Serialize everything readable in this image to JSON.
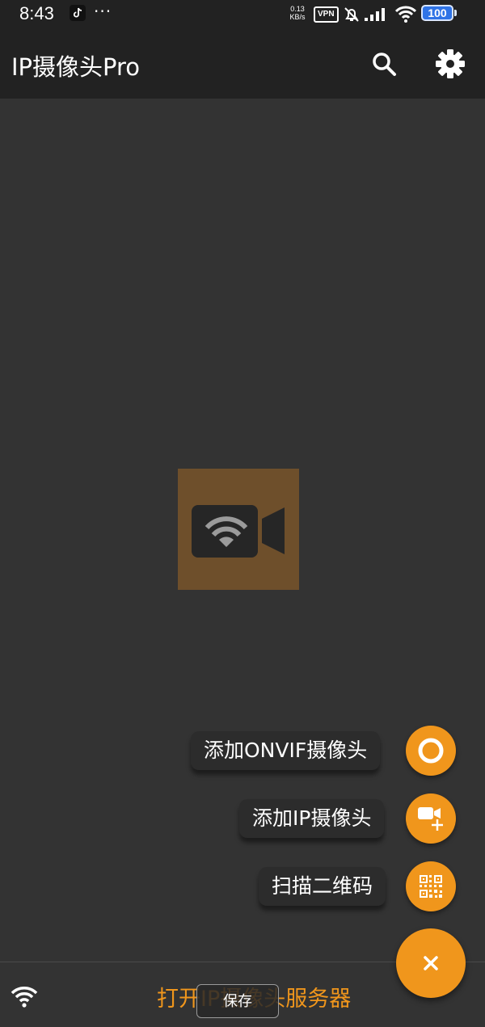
{
  "status_bar": {
    "time": "8:43",
    "notification_icon": "tiktok-icon",
    "more": "···",
    "net_speed_value": "0.13",
    "net_speed_unit": "KB/s",
    "vpn": "VPN",
    "battery": "100"
  },
  "app_bar": {
    "title": "IP摄像头Pro",
    "search_icon": "search-icon",
    "settings_icon": "gear-icon"
  },
  "center": {
    "logo_icon": "wifi-camera-icon"
  },
  "speed_dial": {
    "items": [
      {
        "label": "添加ONVIF摄像头",
        "icon": "onvif-ring-icon"
      },
      {
        "label": "添加IP摄像头",
        "icon": "add-camera-icon"
      },
      {
        "label": "扫描二维码",
        "icon": "qr-code-icon"
      }
    ],
    "close_label": "×"
  },
  "bottom_bar": {
    "wifi_icon": "wifi-icon",
    "server_button": "打开IP摄像头服务器",
    "toast": "保存"
  },
  "colors": {
    "accent": "#f0961c",
    "background": "#333333",
    "appbar": "#222222",
    "logo_bg": "#6e4f2b"
  }
}
